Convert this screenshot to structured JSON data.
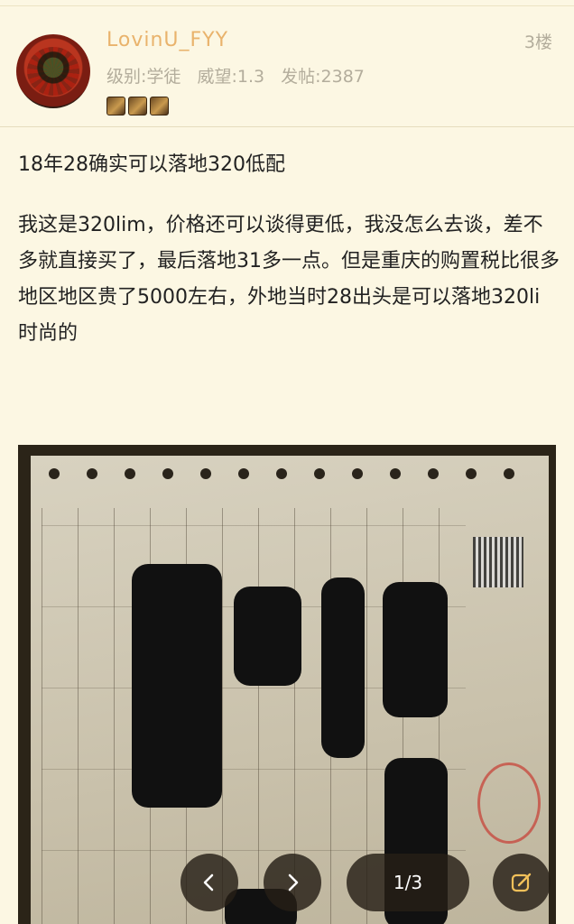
{
  "post": {
    "username": "LovinU_FYY",
    "floor": "3楼",
    "level": "级别:学徒",
    "prestige": "威望:1.3",
    "posts": "发帖:2387",
    "badge_icons": [
      "medal-icon",
      "medal-icon",
      "medal-icon"
    ],
    "line1": "18年28确实可以落地320低配",
    "paragraph": "我这是320lim，价格还可以谈得更低，我没怎么去谈，差不多就直接买了，最后落地31多一点。但是重庆的购置税比很多地区地区贵了5000左右，外地当时28出头是可以落地320li时尚的"
  },
  "image_viewer": {
    "page_indicator": "1/3",
    "prev_icon": "chevron-left-icon",
    "next_icon": "chevron-right-icon",
    "edit_icon": "edit-icon"
  },
  "colors": {
    "background": "#fcf7e3",
    "username": "#e9b36c",
    "meta": "#b3ad9c",
    "body_text": "#222222"
  }
}
